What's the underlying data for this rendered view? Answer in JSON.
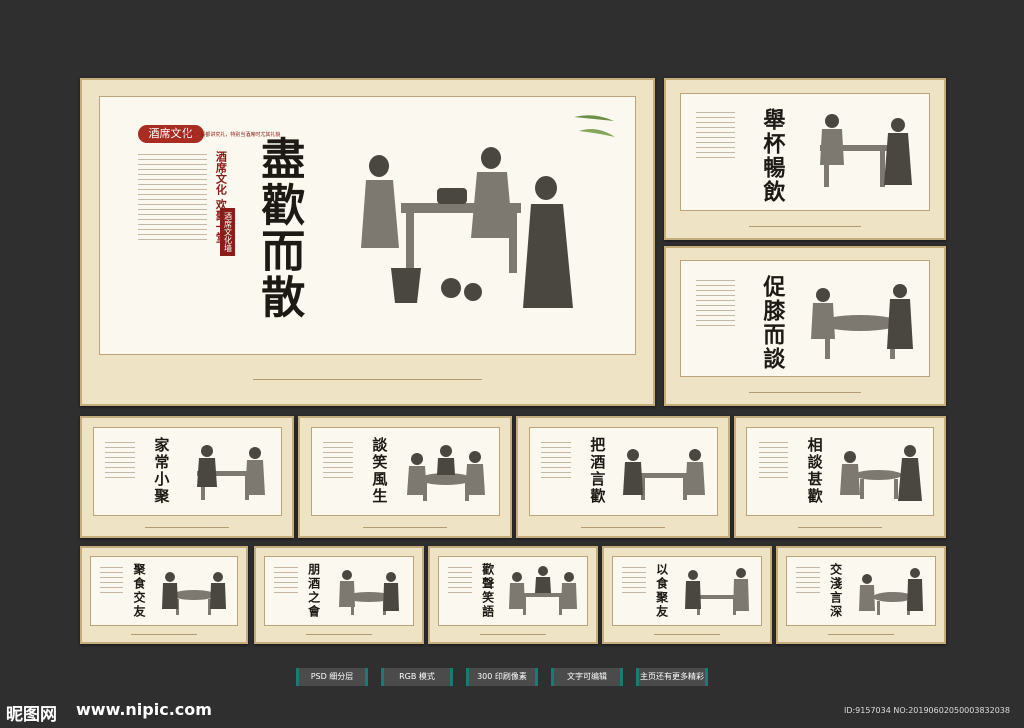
{
  "main": {
    "seal": "酒席文化",
    "slogan": "中国人一般都讲究礼，特别当酒席时尤其礼貌",
    "subtitle": "酒席文化 欢聚一堂",
    "badge": "酒席文化墙",
    "title": "盡歡而散"
  },
  "panels": [
    {
      "id": "p2",
      "title": "舉杯暢飲"
    },
    {
      "id": "p3",
      "title": "促膝而談"
    },
    {
      "id": "p4",
      "title": "家常小聚"
    },
    {
      "id": "p5",
      "title": "談笑風生"
    },
    {
      "id": "p6",
      "title": "把酒言歡"
    },
    {
      "id": "p7",
      "title": "相談甚歡"
    },
    {
      "id": "p8",
      "title": "聚食交友"
    },
    {
      "id": "p9",
      "title": "朋酒之會"
    },
    {
      "id": "p10",
      "title": "歡聲笑語"
    },
    {
      "id": "p11",
      "title": "以食聚友"
    },
    {
      "id": "p12",
      "title": "交淺言深"
    }
  ],
  "tags": [
    "PSD 细分层",
    "RGB 模式",
    "300 印刷像素",
    "文字可编辑",
    "主页还有更多精彩"
  ],
  "watermark": {
    "logo": "昵图网",
    "url": "www.nipic.com",
    "id": "ID:9157034 NO:20190602050003832038"
  }
}
